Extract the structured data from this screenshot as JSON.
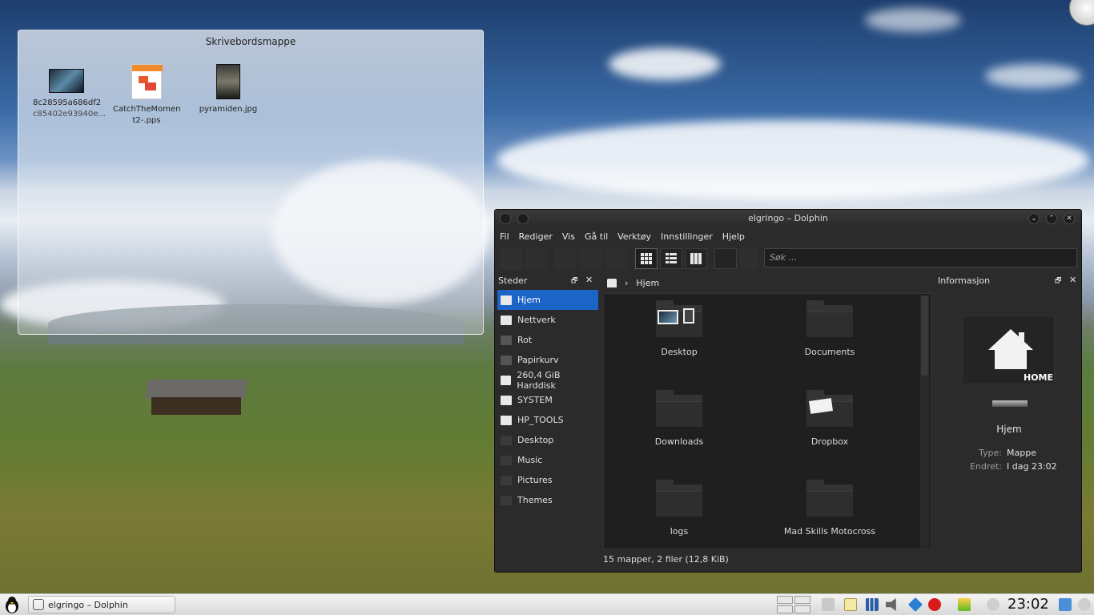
{
  "desktop": {
    "folderview": {
      "title": "Skrivebordsmappe",
      "items": [
        {
          "line1": "8c28595a686df2",
          "line2": "c85402e93940e..."
        },
        {
          "line1": "CatchTheMomen",
          "line2": "t2-.pps"
        },
        {
          "line1": "pyramiden.jpg",
          "line2": ""
        }
      ]
    }
  },
  "dolphin": {
    "title": "elgringo – Dolphin",
    "menu": [
      "Fil",
      "Rediger",
      "Vis",
      "Gå til",
      "Verktøy",
      "Innstillinger",
      "Hjelp"
    ],
    "search_placeholder": "Søk ...",
    "places_title": "Steder",
    "places": [
      {
        "label": "Hjem",
        "selected": true
      },
      {
        "label": "Nettverk"
      },
      {
        "label": "Rot"
      },
      {
        "label": "Papirkurv"
      },
      {
        "label": "260,4 GiB Harddisk"
      },
      {
        "label": "SYSTEM"
      },
      {
        "label": "HP_TOOLS"
      },
      {
        "label": "Desktop"
      },
      {
        "label": "Music"
      },
      {
        "label": "Pictures"
      },
      {
        "label": "Themes"
      }
    ],
    "breadcrumb": {
      "current": "Hjem"
    },
    "folders": [
      "Desktop",
      "Documents",
      "Downloads",
      "Dropbox",
      "logs",
      "Mad Skills Motocross"
    ],
    "status": "15 mapper, 2 filer (12,8 KiB)",
    "info": {
      "title": "Informasjon",
      "home_label": "HOME",
      "name": "Hjem",
      "type_key": "Type:",
      "type_value": "Mappe",
      "modified_key": "Endret:",
      "modified_value": "I dag 23:02"
    }
  },
  "taskbar": {
    "task_label": "elgringo – Dolphin",
    "clock": "23:02"
  },
  "colors": {
    "selection": "#1c64c7",
    "window_bg": "#2b2b2b",
    "taskbar": "#e6e6e6"
  }
}
